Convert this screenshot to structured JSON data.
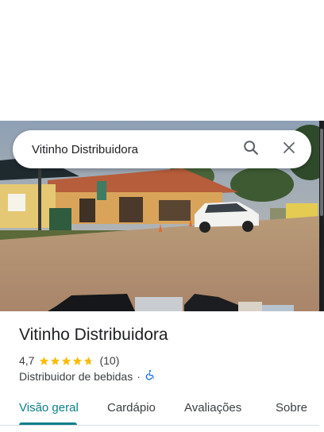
{
  "search": {
    "query": "Vitinho Distribuidora"
  },
  "place": {
    "name": "Vitinho Distribuidora",
    "rating": "4,7",
    "stars": 4.7,
    "reviews": "(10)",
    "category": "Distribuidor de bebidas",
    "separator": "·"
  },
  "tabs": [
    {
      "label": "Visão geral",
      "active": true
    },
    {
      "label": "Cardápio",
      "active": false
    },
    {
      "label": "Avaliações",
      "active": false
    },
    {
      "label": "Sobre",
      "active": false
    }
  ],
  "colors": {
    "accent": "#0b7f8a",
    "star": "#fbbc04",
    "accessibility": "#1a73e8"
  },
  "icons": {
    "search": "search-icon",
    "close": "close-icon",
    "accessibility": "wheelchair-icon"
  }
}
